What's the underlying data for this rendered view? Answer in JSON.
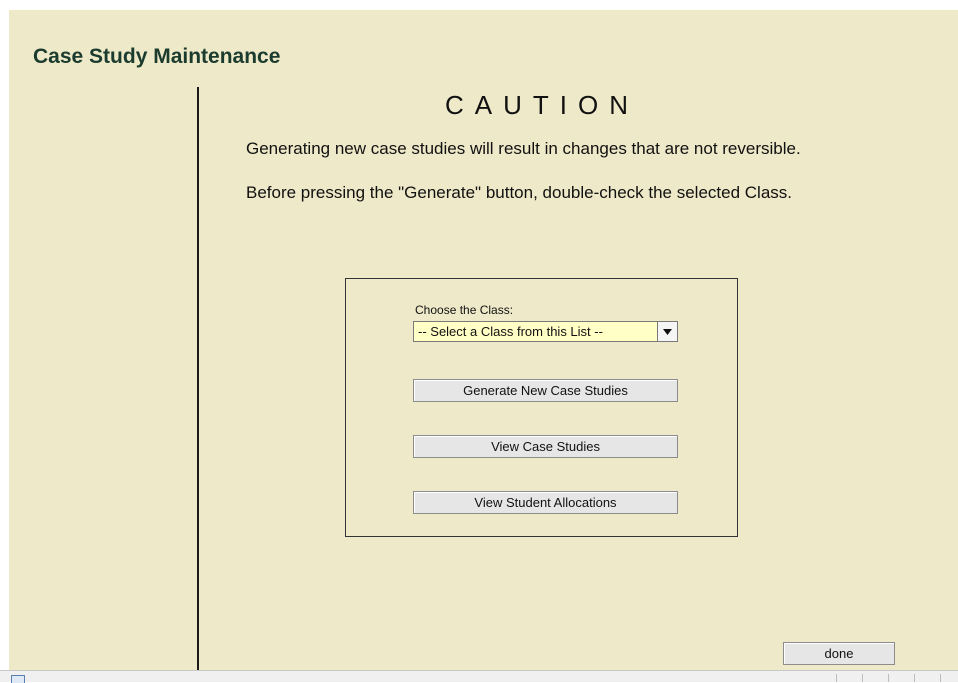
{
  "page": {
    "title": "Case Study Maintenance",
    "caution_heading": "CAUTION",
    "messages": [
      "Generating new case studies will result in changes that are not reversible.",
      "Before pressing the \"Generate\" button, double-check the selected Class."
    ]
  },
  "form": {
    "class_label": "Choose the Class:",
    "class_select_value": "-- Select a Class from this List --",
    "generate_button": "Generate New Case Studies",
    "view_case_studies_button": "View Case Studies",
    "view_allocations_button": "View Student Allocations"
  },
  "footer": {
    "done_button": "done"
  },
  "icons": {
    "select_arrow": "chevron-down-icon",
    "status_page": "page-icon"
  },
  "colors": {
    "background": "#eee9c8",
    "title": "#1b3b2e",
    "select_bg": "#ffffc6"
  }
}
